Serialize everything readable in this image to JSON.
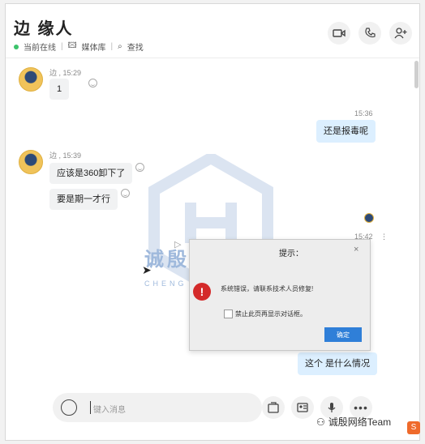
{
  "header": {
    "title": "边 缘人",
    "status": "当前在线",
    "media_library": "媒体库",
    "search": "查找"
  },
  "messages": [
    {
      "sender": "边",
      "time": "15:29",
      "text": "1"
    },
    {
      "time": "15:36",
      "text": "还是报毒呢"
    },
    {
      "sender": "边",
      "time": "15:39",
      "text": "应该是360卸下了"
    },
    {
      "text": "要是期一才行"
    },
    {
      "time": "15:42",
      "text": "这个 是什么情况"
    }
  ],
  "dialog": {
    "title": "提示：",
    "close": "×",
    "message": "系统错误，请联系技术人员修复!",
    "checkbox_label": "禁止此页再显示对话框。",
    "ok": "确定"
  },
  "composer": {
    "placeholder": "键入消息"
  },
  "watermark": {
    "text": "诚殷网络",
    "sub": "CHENG"
  },
  "brand": {
    "text": "诚殷网络Team"
  },
  "colors": {
    "online": "#3bc36b",
    "bubble_out": "#dcefff",
    "bubble_in": "#f1f2f3",
    "error": "#d42a2a",
    "button": "#2f7fd8"
  }
}
